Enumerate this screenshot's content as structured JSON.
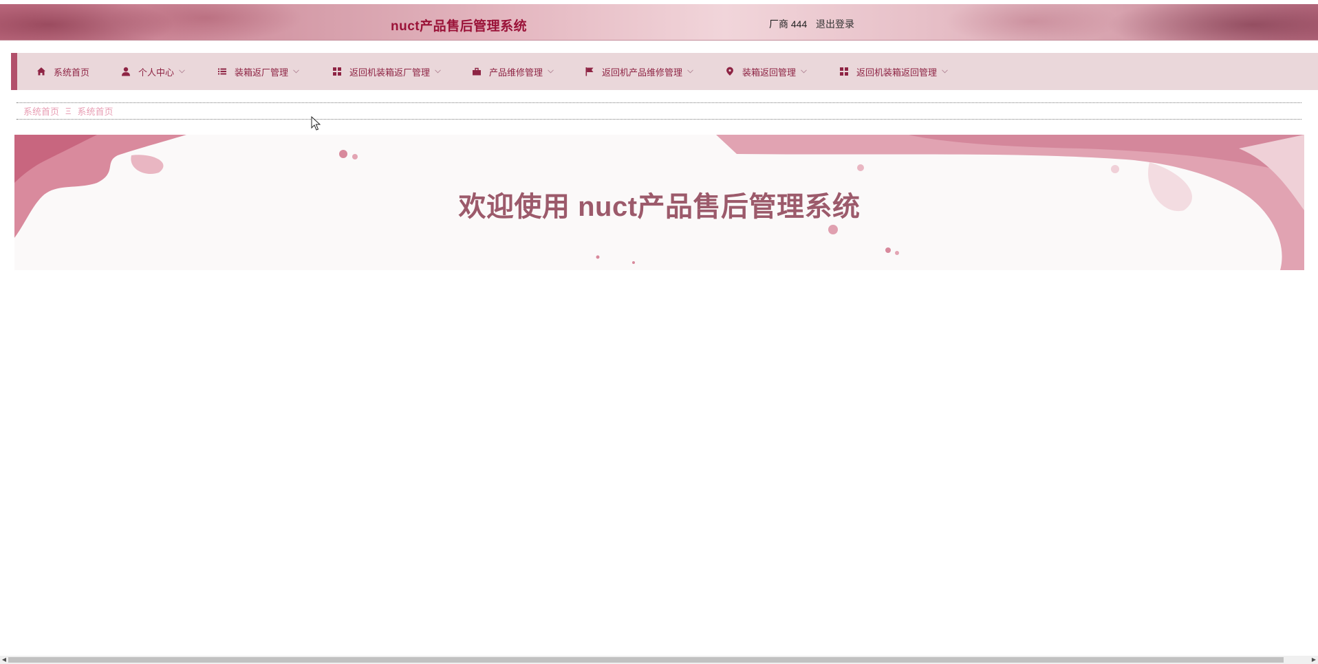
{
  "header": {
    "title": "nuct产品售后管理系统",
    "user": "厂商 444",
    "logout": "退出登录"
  },
  "nav": {
    "items": [
      {
        "label": "系统首页",
        "icon": "home-icon",
        "dropdown": false
      },
      {
        "label": "个人中心",
        "icon": "user-icon",
        "dropdown": true
      },
      {
        "label": "装箱返厂管理",
        "icon": "list-icon",
        "dropdown": true
      },
      {
        "label": "返回机装箱返厂管理",
        "icon": "grid-icon",
        "dropdown": true
      },
      {
        "label": "产品维修管理",
        "icon": "briefcase-icon",
        "dropdown": true
      },
      {
        "label": "返回机产品维修管理",
        "icon": "flag-icon",
        "dropdown": true
      },
      {
        "label": "装箱返回管理",
        "icon": "map-pin-icon",
        "dropdown": true
      },
      {
        "label": "返回机装箱返回管理",
        "icon": "grid-icon",
        "dropdown": true
      }
    ]
  },
  "breadcrumb": {
    "items": [
      "系统首页",
      "系统首页"
    ],
    "separator": "Ξ"
  },
  "banner": {
    "welcome": "欢迎使用 nuct产品售后管理系统"
  },
  "colors": {
    "accent": "#b2506b",
    "nav_bg": "#ead7da",
    "nav_text": "#8e2444",
    "title": "#9a1238",
    "welcome": "#9c5a6b",
    "breadcrumb": "#e89db3"
  }
}
